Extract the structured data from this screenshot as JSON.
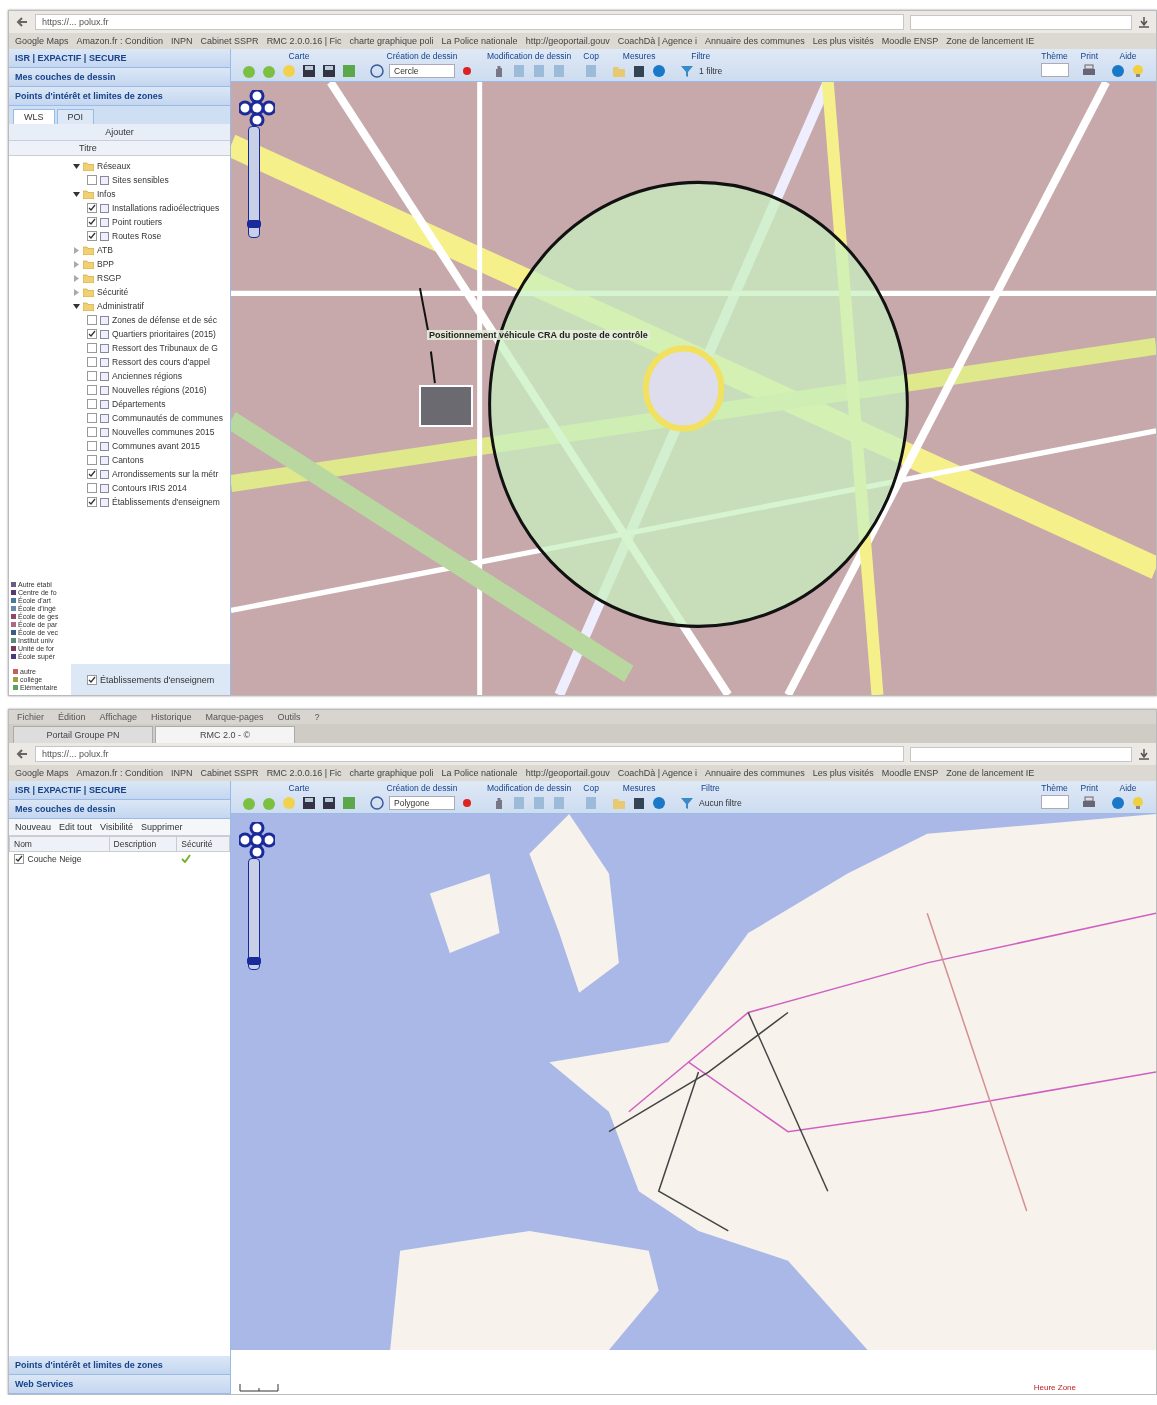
{
  "windows": [
    {
      "address": "https://... polux.fr",
      "bookmarks": [
        "Google Maps",
        "Amazon.fr : Condition",
        "INPN",
        "Cabinet SSPR",
        "RMC 2.0.0.16 | Fic",
        "charte graphique poli",
        "La Police nationale",
        "http://geoportail.gouv",
        "CoachDà | Agence i",
        "Annuaire des communes",
        "Les plus visités",
        "Moodle ENSP",
        "Zone de lancement IE"
      ],
      "sidebar": {
        "title": "ISR | EXPACTIF | SECURE",
        "panels": [
          "Mes couches de dessin",
          "Points d'intérêt et limites de zones"
        ],
        "tabs": [
          {
            "label": "WLS",
            "selected": true
          },
          {
            "label": "POI",
            "selected": false
          }
        ],
        "tree_tool": "Ajouter",
        "tree_header": "Titre",
        "tree": [
          {
            "kind": "folder",
            "label": "Réseaux",
            "expanded": true,
            "children": [
              {
                "kind": "layer",
                "label": "Sites sensibles",
                "checked": false
              }
            ]
          },
          {
            "kind": "folder",
            "label": "Infos",
            "expanded": true,
            "children": [
              {
                "kind": "layer",
                "label": "Installations radioélectriques",
                "checked": true
              },
              {
                "kind": "layer",
                "label": "Point routiers",
                "checked": true
              },
              {
                "kind": "layer",
                "label": "Routes Rose",
                "checked": true
              }
            ]
          },
          {
            "kind": "folder",
            "label": "ATB",
            "expanded": false
          },
          {
            "kind": "folder",
            "label": "BPP",
            "expanded": false
          },
          {
            "kind": "folder",
            "label": "RSGP",
            "expanded": false
          },
          {
            "kind": "folder",
            "label": "Sécurité",
            "expanded": false
          },
          {
            "kind": "folder",
            "label": "Administratif",
            "expanded": true,
            "children": [
              {
                "kind": "layer",
                "label": "Zones de défense et de séc",
                "checked": false
              },
              {
                "kind": "layer",
                "label": "Quartiers prioritaires (2015)",
                "checked": true
              },
              {
                "kind": "layer",
                "label": "Ressort des Tribunaux de G",
                "checked": false
              },
              {
                "kind": "layer",
                "label": "Ressort des cours d'appel",
                "checked": false
              },
              {
                "kind": "layer",
                "label": "Anciennes régions",
                "checked": false
              },
              {
                "kind": "layer",
                "label": "Nouvelles régions (2016)",
                "checked": false
              },
              {
                "kind": "layer",
                "label": "Départements",
                "checked": false
              },
              {
                "kind": "layer",
                "label": "Communautés de communes",
                "checked": false
              },
              {
                "kind": "layer",
                "label": "Nouvelles communes 2015",
                "checked": false
              },
              {
                "kind": "layer",
                "label": "Communes avant 2015",
                "checked": false
              },
              {
                "kind": "layer",
                "label": "Cantons",
                "checked": false
              },
              {
                "kind": "layer",
                "label": "Arrondissements sur la métr",
                "checked": true
              },
              {
                "kind": "layer",
                "label": "Contours IRIS 2014",
                "checked": false
              },
              {
                "kind": "layer",
                "label": "Établissements d'enseignem",
                "checked": true
              }
            ]
          }
        ],
        "legend": [
          {
            "label": "Autre établ",
            "color": "#6a5a8a"
          },
          {
            "label": "Centre de fo",
            "color": "#5a3a6a"
          },
          {
            "label": "École d'art",
            "color": "#4a7a9a"
          },
          {
            "label": "École d'ingé",
            "color": "#6a8aaa"
          },
          {
            "label": "École de ges",
            "color": "#8a4a6a"
          },
          {
            "label": "École de par",
            "color": "#aa6a8a"
          },
          {
            "label": "École de vec",
            "color": "#3a5a8a"
          },
          {
            "label": "Institut univ",
            "color": "#5a8a7a"
          },
          {
            "label": "Unité de for",
            "color": "#7a3a5a"
          },
          {
            "label": "École supér",
            "color": "#4a3a7a"
          }
        ],
        "footer_layer": {
          "label": "Établissements d'enseignem",
          "checked": true
        },
        "legend2": [
          {
            "label": "autre",
            "color": "#c06060"
          },
          {
            "label": "collège",
            "color": "#a0a040"
          },
          {
            "label": "Elémentaire",
            "color": "#60a060"
          }
        ]
      },
      "toolbar": {
        "groups": [
          "Carte",
          "Création de dessin",
          "Modification de dessin",
          "Cop",
          "Mesures",
          "Filtre"
        ],
        "shape": "Cercle",
        "filter": "1 filtre",
        "right": [
          "Thème",
          "Print",
          "Aide"
        ]
      },
      "map": {
        "kind": "street",
        "callout": "Positionnement véhicule CRA du poste de contrôle",
        "zoom": {
          "level": 0.08
        }
      }
    },
    {
      "menu": [
        "Fichier",
        "Édition",
        "Affichage",
        "Historique",
        "Marque-pages",
        "Outils",
        "?"
      ],
      "tabs": [
        {
          "label": "Portail Groupe PN",
          "selected": false
        },
        {
          "label": "RMC 2.0 - ©",
          "selected": true
        }
      ],
      "address": "https://... polux.fr",
      "bookmarks": [
        "Google Maps",
        "Amazon.fr : Condition",
        "INPN",
        "Cabinet SSPR",
        "RMC 2.0.0.16 | Fic",
        "charte graphique poli",
        "La Police nationale",
        "http://geoportail.gouv",
        "CoachDà | Agence i",
        "Annuaire des communes",
        "Les plus visités",
        "Moodle ENSP",
        "Zone de lancement IE"
      ],
      "sidebar": {
        "title": "ISR | EXPACTIF | SECURE",
        "panels": [
          "Mes couches de dessin"
        ],
        "actions": [
          "Nouveau",
          "Edit tout",
          "Visibilité",
          "Supprimer"
        ],
        "columns": [
          "Nom",
          "Description",
          "Sécurité"
        ],
        "rows": [
          {
            "name": "Couche Neige",
            "checked": true
          }
        ],
        "bottom_panels": [
          "Points d'intérêt et limites de zones",
          "Web Services"
        ]
      },
      "toolbar": {
        "groups": [
          "Carte",
          "Création de dessin",
          "Modification de dessin",
          "Cop",
          "Mesures",
          "Filtre"
        ],
        "shape": "Polygone",
        "filter": "Aucun filtre",
        "right": [
          "Thème",
          "Print",
          "Aide"
        ]
      },
      "map": {
        "kind": "europe",
        "zoom": {
          "level": 0.04
        }
      },
      "status": "Heure Zone"
    }
  ]
}
